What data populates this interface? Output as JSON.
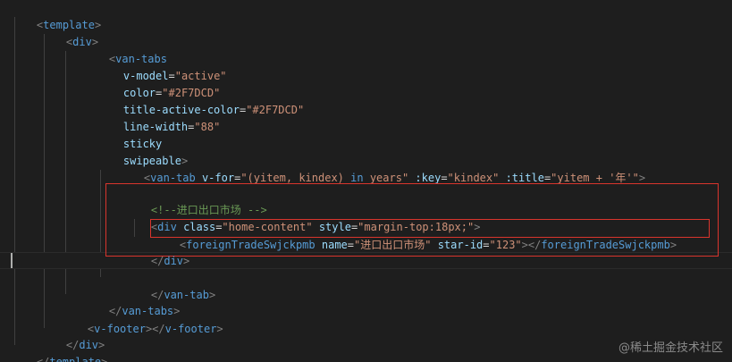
{
  "code": {
    "l1": "template",
    "l2": "div",
    "l3": "van-tabs",
    "l4_attr": "v-model",
    "l4_val": "\"active\"",
    "l5_attr": "color",
    "l5_val": "\"#2F7DCD\"",
    "l6_attr": "title-active-color",
    "l6_val": "\"#2F7DCD\"",
    "l7_attr": "line-width",
    "l7_val": "\"88\"",
    "l8": "sticky",
    "l9": "swipeable",
    "l10_tag": "van-tab",
    "l10_attr1": "v-for",
    "l10_val1_a": "\"(yitem, kindex) ",
    "l10_kw": "in",
    "l10_val1_b": " years\"",
    "l10_attr2": ":key",
    "l10_val2": "\"kindex\"",
    "l10_attr3": ":title",
    "l10_val3_a": "\"yitem + ",
    "l10_val3_b": "'年'",
    "l10_val3_c": "\"",
    "l12_comment": "<!--进口出口市场 -->",
    "l13_tag": "div",
    "l13_attr1": "class",
    "l13_val1": "\"home-content\"",
    "l13_attr2": "style",
    "l13_val2": "\"margin-top:18px;\"",
    "l14_tag": "foreignTradeSwjckpmb",
    "l14_attr1": "name",
    "l14_val1": "\"进口出口市场\"",
    "l14_attr2": "star-id",
    "l14_val2": "\"123\"",
    "l14_close": "foreignTradeSwjckpmb",
    "l15": "div",
    "l17": "van-tab",
    "l18": "van-tabs",
    "l19_open": "v-footer",
    "l19_close": "v-footer",
    "l20": "div",
    "l21": "template"
  },
  "watermark": "@稀土掘金技术社区",
  "colors": {
    "background": "#1e1e1e",
    "tag": "#569cd6",
    "attribute": "#9cdcfe",
    "string": "#ce9178",
    "comment": "#6a9955",
    "highlight_box": "#d9352d"
  }
}
